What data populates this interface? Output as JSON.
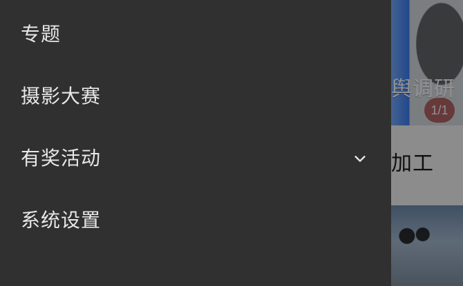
{
  "drawer": {
    "items": [
      {
        "label": "专题"
      },
      {
        "label": "摄影大赛"
      },
      {
        "label": "有奖活动",
        "icon": "chevron-down-icon"
      },
      {
        "label": "系统设置"
      }
    ]
  },
  "background": {
    "title_top": "舆调研",
    "badge": "1/1",
    "title_mid": "加工"
  },
  "colors": {
    "drawer_bg": "#303030",
    "text": "#e8e8e8"
  }
}
